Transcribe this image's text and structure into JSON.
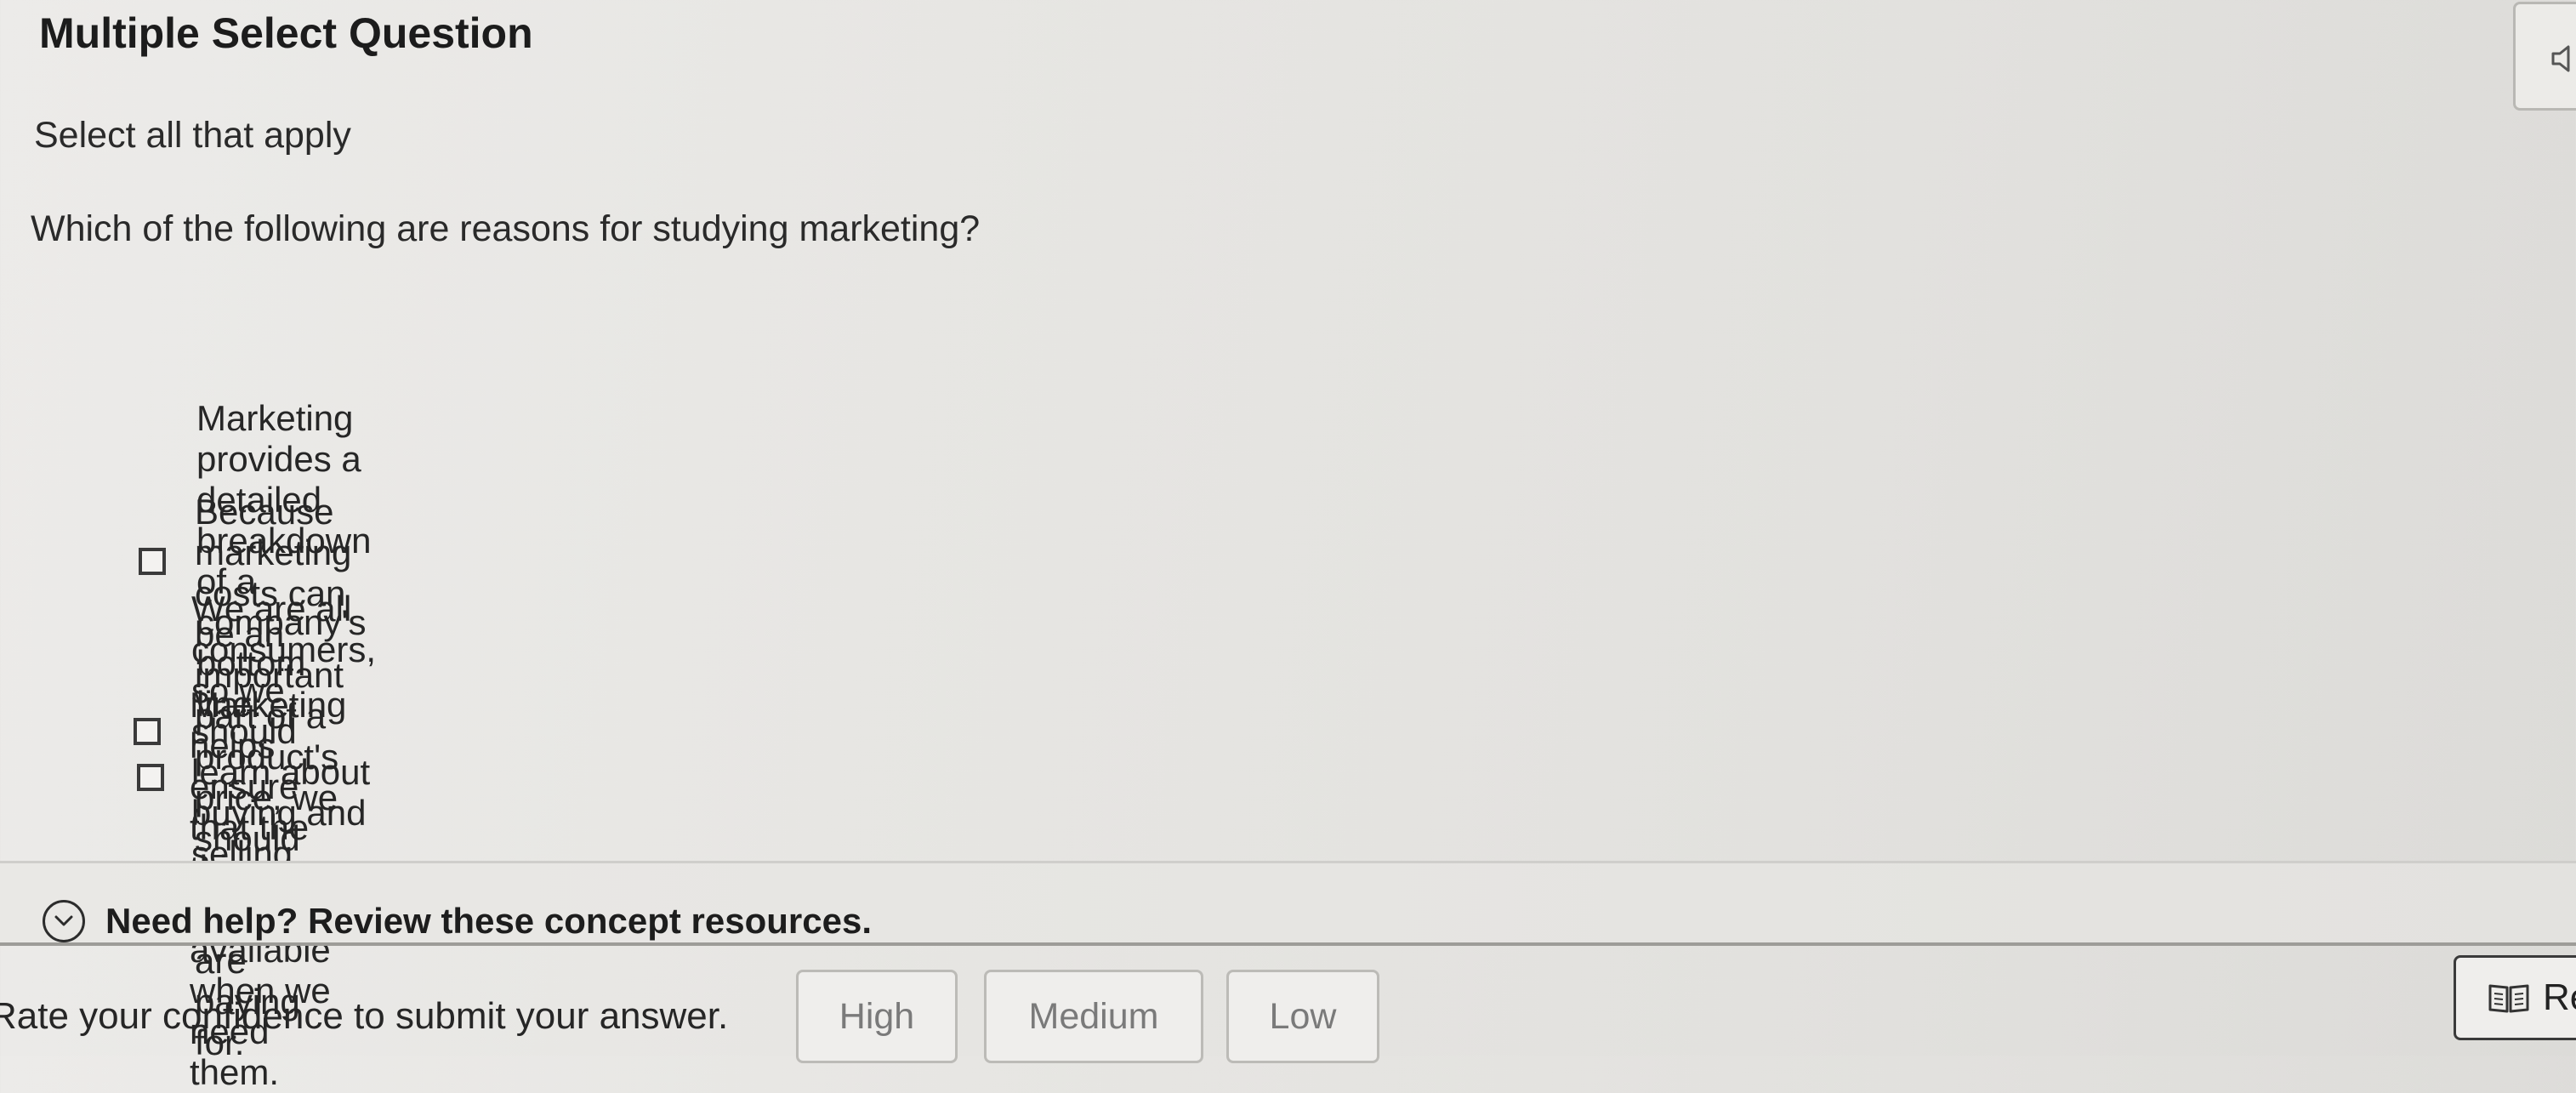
{
  "question": {
    "type_title": "Multiple Select Question",
    "instruction": "Select all that apply",
    "prompt": "Which of the following are reasons for studying marketing?"
  },
  "options": [
    {
      "label": "Marketing provides a detailed breakdown of a company's bottom line.",
      "checked": false
    },
    {
      "label": "Because marketing costs can be an important part of a product's price, we should know what we are paying for.",
      "checked": false
    },
    {
      "label": "We are all consumers, so we should learn about buying and selling.",
      "checked": false
    },
    {
      "label": "Marketing helps ensure that the things we buy are available when we need them.",
      "checked": false
    }
  ],
  "help": {
    "label": "Need help? Review these concept resources.",
    "icon": "chevron-down-icon"
  },
  "confidence": {
    "label": "Rate your confidence to submit your answer.",
    "buttons": [
      "High",
      "Medium",
      "Low"
    ]
  },
  "reader": {
    "label": "Re",
    "icon": "book-icon"
  },
  "audio": {
    "icon": "speaker-icon"
  }
}
